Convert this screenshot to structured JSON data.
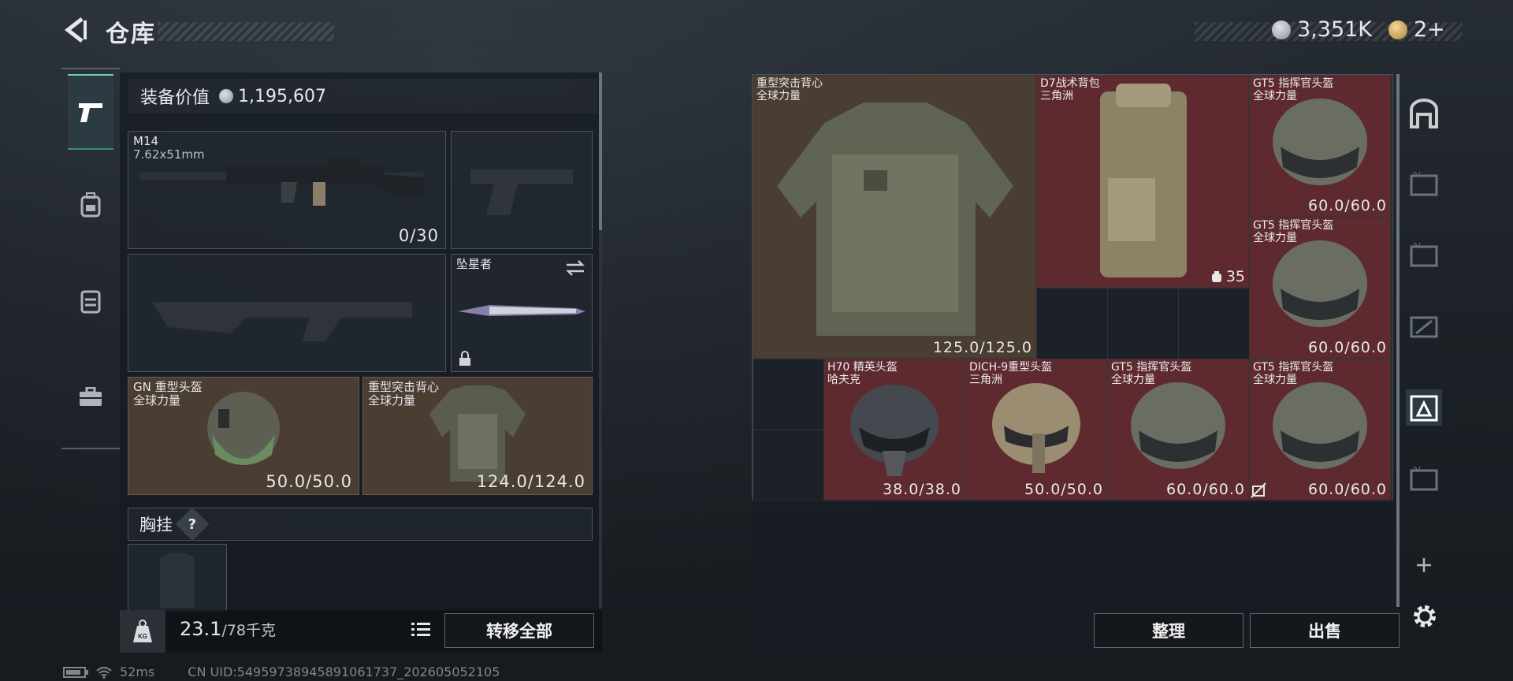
{
  "header": {
    "title": "仓库",
    "currency_a": "3,351K",
    "currency_b": "2+"
  },
  "left": {
    "equip_label": "装备价值",
    "equip_value": "1,195,607",
    "weapon1": {
      "name": "M14",
      "caliber": "7.62x51mm",
      "ammo": "0/30"
    },
    "melee": {
      "name": "坠星者"
    },
    "helmet": {
      "name": "GN 重型头盔",
      "faction": "全球力量",
      "durability": "50.0/50.0"
    },
    "armor": {
      "name": "重型突击背心",
      "faction": "全球力量",
      "durability": "124.0/124.0"
    },
    "chest_label": "胸挂",
    "chest_hint": "?",
    "weight_value": "23.1",
    "weight_max": "/78千克",
    "weight_icon_text": "KG",
    "transfer_all": "转移全部"
  },
  "grid_items": [
    {
      "name": "重型突击背心",
      "faction": "全球力量",
      "value": "125.0/125.0"
    },
    {
      "name": "D7战术背包",
      "faction": "三角洲",
      "value": "35"
    },
    {
      "name": "GT5 指挥官头盔",
      "faction": "全球力量",
      "value": "60.0/60.0"
    },
    {
      "name": "GT5 指挥官头盔",
      "faction": "全球力量",
      "value": "60.0/60.0"
    },
    {
      "name": "H70 精英头盔",
      "faction": "哈夫克",
      "value": "38.0/38.0"
    },
    {
      "name": "DICH-9重型头盔",
      "faction": "三角洲",
      "value": "50.0/50.0"
    },
    {
      "name": "GT5 指挥官头盔",
      "faction": "全球力量",
      "value": "60.0/60.0"
    },
    {
      "name": "GT5 指挥官头盔",
      "faction": "全球力量",
      "value": "60.0/60.0"
    }
  ],
  "right": {
    "organize": "整理",
    "sell": "出售"
  },
  "status": {
    "ping": "52ms",
    "uid": "CN UID:5495973894589106173​7_202605052105"
  },
  "colors": {
    "accent": "#6ad1b8",
    "item_red": "#5e2a30",
    "item_brown": "#4a3d32"
  }
}
